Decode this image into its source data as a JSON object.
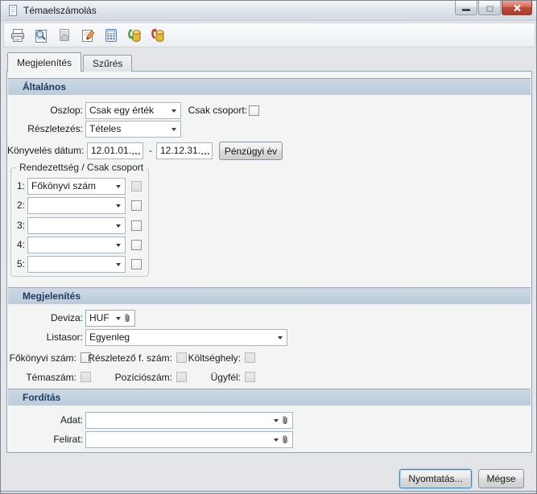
{
  "window": {
    "title": "Témaelszámolás"
  },
  "toolbar": {
    "buttons": [
      "printer",
      "print-preview",
      "page-copy",
      "edit-document",
      "calculator-table",
      "database-import",
      "database-export"
    ]
  },
  "tabs": [
    {
      "label": "Megjelenítés",
      "active": true
    },
    {
      "label": "Szűrés",
      "active": false
    }
  ],
  "altalanos": {
    "title": "Általános",
    "oszlop_label": "Oszlop:",
    "oszlop_value": "Csak egy érték",
    "csak_csoport_label": "Csak csoport:",
    "csak_csoport_checked": false,
    "reszletezes_label": "Részletezés:",
    "reszletezes_value": "Tételes",
    "konyveles_datum_label": "Könyvelés dátum:",
    "datum_tol": "12.01.01.",
    "datum_ig": "12.12.31.",
    "datum_separator": "-",
    "datum_picker_glyph": "…",
    "penzugyi_ev_button": "Pénzügyi év",
    "rendezettseg": {
      "title": "Rendezettség / Csak csoport",
      "rows": [
        {
          "num": "1:",
          "value": "Főkönyvi szám",
          "checkbox_enabled": false,
          "checked": false
        },
        {
          "num": "2:",
          "value": "",
          "checkbox_enabled": true,
          "checked": false
        },
        {
          "num": "3:",
          "value": "",
          "checkbox_enabled": true,
          "checked": false
        },
        {
          "num": "4:",
          "value": "",
          "checkbox_enabled": true,
          "checked": false
        },
        {
          "num": "5:",
          "value": "",
          "checkbox_enabled": true,
          "checked": false
        }
      ]
    }
  },
  "megjelenites": {
    "title": "Megjelenítés",
    "deviza_label": "Deviza:",
    "deviza_value": "HUF",
    "listasor_label": "Listasor:",
    "listasor_value": "Egyenleg",
    "checkboxes": [
      {
        "label": "Főkönyvi szám:",
        "enabled": true,
        "checked": false
      },
      {
        "label": "Részletező f. szám:",
        "enabled": false,
        "checked": false
      },
      {
        "label": "Költséghely:",
        "enabled": false,
        "checked": false
      },
      {
        "label": "Témaszám:",
        "enabled": false,
        "checked": false
      },
      {
        "label": "Pozíciószám:",
        "enabled": false,
        "checked": false
      },
      {
        "label": "Ügyfél:",
        "enabled": false,
        "checked": false
      }
    ]
  },
  "forditas": {
    "title": "Fordítás",
    "adat_label": "Adat:",
    "adat_value": "",
    "felirat_label": "Felirat:",
    "felirat_value": ""
  },
  "footer": {
    "print_button": "Nyomtatás...",
    "cancel_button": "Mégse"
  },
  "colors": {
    "section_header_bg": "#c4d2e0",
    "section_header_text": "#1f3d60",
    "close_button": "#c14d3b",
    "focus_border": "#3c7fb1"
  }
}
